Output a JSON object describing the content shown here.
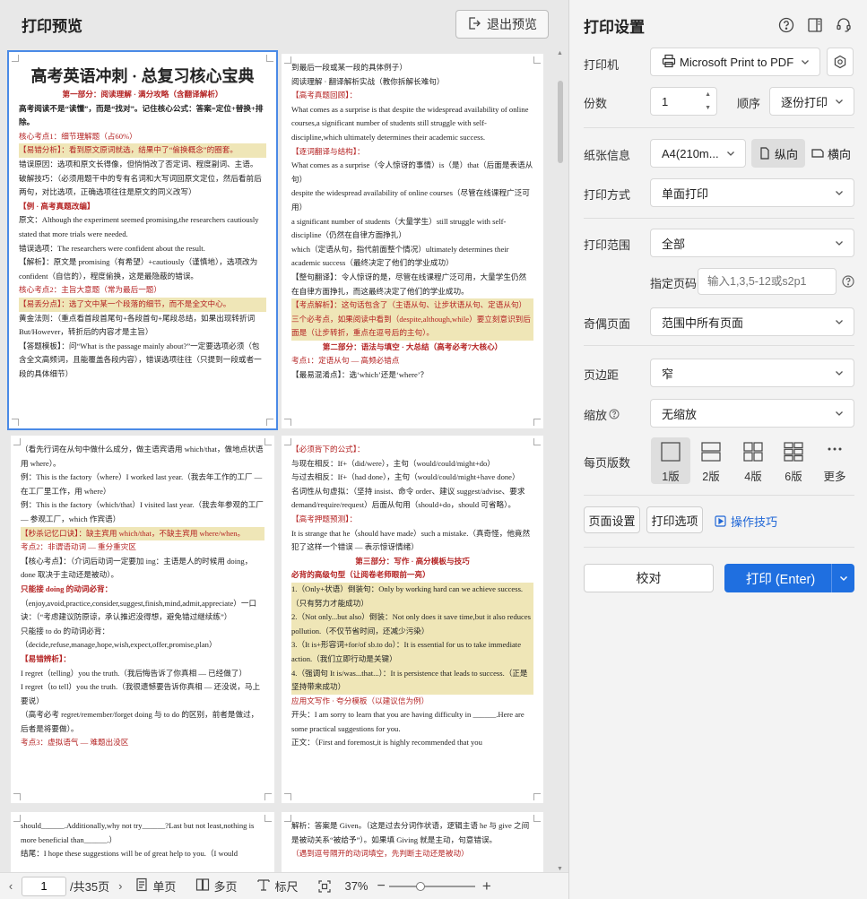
{
  "preview": {
    "title": "打印预览",
    "exit_label": "退出预览",
    "pages": [
      {
        "title": "高考英语冲刺 · 总复习核心宝典",
        "lines": [
          {
            "t": "第一部分：阅读理解 · 满分攻略（含翻译解析）",
            "c": "red bold center"
          },
          {
            "t": "高考阅读不是“读懂”，而是“找对”。记住核心公式：答案=定位+替换+排除。",
            "c": "bold"
          },
          {
            "t": "核心考点1：细节理解题（占60%）",
            "c": "red"
          },
          {
            "t": "【易错分析】：看到原文原词就选，结果中了“偷换概念”的圈套。",
            "c": "red hl"
          },
          {
            "t": "错误原因：选项和原文长得像，但悄悄改了否定词、程度副词、主语。",
            "c": ""
          },
          {
            "t": "破解技巧：（必须用题干中的专有名词和大写词回原文定位，然后看前后两句，对比选项，正确选项往往是原文的同义改写）",
            "c": ""
          },
          {
            "t": "【例 · 高考真题改编】",
            "c": "red bold"
          },
          {
            "t": "原文：Although the experiment seemed promising,the researchers cautiously stated that more trials were needed.",
            "c": ""
          },
          {
            "t": "错误选项：The researchers were confident about the result.",
            "c": ""
          },
          {
            "t": "【解析】：原文是 promising（有希望）+cautiously（谨慎地），选项改为 confident（自信的），程度偷换，这是最隐蔽的错误。",
            "c": ""
          },
          {
            "t": "核心考点2：主旨大意题（常为最后一题）",
            "c": "red"
          },
          {
            "t": "【易丢分点】：选了文中某一个段落的细节，而不是全文中心。",
            "c": "red hl"
          },
          {
            "t": "黄金法则：（重点看首段首尾句+各段首句+尾段总结，如果出现转折词 But/However，转折后的内容才是主旨）",
            "c": ""
          },
          {
            "t": "【答题模板】：问“What is the passage mainly about?”一定要选项必须（包含全文高频词，且能覆盖各段内容），错误选项往往（只提到一段或者一段的具体细节）",
            "c": ""
          }
        ]
      },
      {
        "lines": [
          {
            "t": "到最后一段或某一段的具体例子）",
            "c": ""
          },
          {
            "t": "阅读理解 · 翻译解析实战（教你拆解长难句）",
            "c": ""
          },
          {
            "t": "【高考真题回顾】：",
            "c": "red"
          },
          {
            "t": "What comes as a surprise is that despite the widespread availability of online courses,a significant number of students still struggle with self-discipline,which ultimately determines their academic success.",
            "c": ""
          },
          {
            "t": "【逐词翻译与结构】：",
            "c": "red"
          },
          {
            "t": "What comes as a surprise（令人惊讶的事情）is（是）that（后面是表语从句）",
            "c": ""
          },
          {
            "t": "despite the widespread availability of online courses（尽管在线课程广泛可用）",
            "c": ""
          },
          {
            "t": "a significant number of students（大量学生）still struggle with self-discipline（仍然在自律方面挣扎）",
            "c": ""
          },
          {
            "t": "which（定语从句，指代前面整个情况）ultimately determines their academic success（最终决定了他们的学业成功）",
            "c": ""
          },
          {
            "t": "【整句翻译】：令人惊讶的是，尽管在线课程广泛可用，大量学生仍然在自律方面挣扎，而这最终决定了他们的学业成功。",
            "c": ""
          },
          {
            "t": "【考点解析】：这句话包含了（主语从句、让步状语从句、定语从句）三个必考点，如果阅读中看到（despite,although,while）要立刻意识到后面是（让步转折，重点在逗号后的主句）。",
            "c": "red hl"
          },
          {
            "t": "第二部分：语法与填空 · 大总结（高考必考7大核心）",
            "c": "red bold center"
          },
          {
            "t": "考点1：定语从句 — 高频必错点",
            "c": "red"
          },
          {
            "t": "【最易混淆点】：选‘which’还是‘where’？",
            "c": ""
          }
        ]
      },
      {
        "lines": [
          {
            "t": "（看先行词在从句中做什么成分，做主语宾语用 which/that，做地点状语用 where）。",
            "c": ""
          },
          {
            "t": "例：This is the factory（where）I worked last year.（我去年工作的工厂 — 在工厂里工作，用 where）",
            "c": ""
          },
          {
            "t": "例：This is the factory（which/that）I visited last year.（我去年参观的工厂 — 参观工厂，which 作宾语）",
            "c": ""
          },
          {
            "t": "【秒杀记忆口诀】：缺主宾用 which/that，不缺主宾用 where/when。",
            "c": "red hl"
          },
          {
            "t": "考点2：非谓语动词 — 重分重灾区",
            "c": "red"
          },
          {
            "t": "【核心考点】：（介词后动词一定要加 ing：主语是人的时候用 doing，done 取决于主动还是被动）。",
            "c": ""
          },
          {
            "t": "只能接 doing 的动词必背：",
            "c": "red bold"
          },
          {
            "t": "（enjoy,avoid,practice,consider,suggest,finish,mind,admit,appreciate）一口诀：（“考虑建议防原谅，承认推迟没得想，避免错过继续练”）",
            "c": ""
          },
          {
            "t": "只能接 to do 的动词必背：",
            "c": ""
          },
          {
            "t": "（decide,refuse,manage,hope,wish,expect,offer,promise,plan）",
            "c": ""
          },
          {
            "t": "【易错辨析】：",
            "c": "red bold"
          },
          {
            "t": "I regret（telling）you the truth.（我后悔告诉了你真相 — 已经做了）",
            "c": ""
          },
          {
            "t": "I regret（to tell）you the truth.（我很遗憾要告诉你真相 — 还没说，马上要说）",
            "c": ""
          },
          {
            "t": "（高考必考 regret/remember/forget doing 与 to do 的区别，前者是做过，后者是将要做）。",
            "c": ""
          },
          {
            "t": "考点3：虚拟语气 — 难题出没区",
            "c": "red"
          }
        ]
      },
      {
        "lines": [
          {
            "t": "【必须背下的公式】：",
            "c": "red"
          },
          {
            "t": "与现在相反：If+（did/were），主句（would/could/might+do）",
            "c": ""
          },
          {
            "t": "与过去相反：If+（had done），主句（would/could/might+have done）",
            "c": ""
          },
          {
            "t": "名词性从句虚拟：（坚持 insist、命令 order、建议 suggest/advise、要求 demand/require/request）后面从句用（should+do，should 可省略）。",
            "c": ""
          },
          {
            "t": "【高考押题预测】：",
            "c": "red"
          },
          {
            "t": "It is strange that he（should have made）such a mistake.（真奇怪，他竟然犯了这样一个错误 — 表示惊讶情绪）",
            "c": ""
          },
          {
            "t": "第三部分：写作 · 高分模板与技巧",
            "c": "red bold center"
          },
          {
            "t": "必背的高级句型（让阅卷老师眼前一亮）",
            "c": "red bold"
          },
          {
            "t": "1.（Only+状语）倒装句：Only by working hard can we achieve success.（只有努力才能成功）",
            "c": "hl"
          },
          {
            "t": "2.（Not only...but also）倒装：Not only does it save time,but it also reduces pollution.（不仅节省时间，还减少污染）",
            "c": "hl"
          },
          {
            "t": "3.（It is+形容词+for/of sb.to do）：It is essential for us to take immediate action.（我们立即行动是关键）",
            "c": "hl"
          },
          {
            "t": "4.（强调句 It is/was...that...）：It is persistence that leads to success.（正是坚持带来成功）",
            "c": "hl"
          },
          {
            "t": "应用文写作 · 夸分模板（以建议信为例）",
            "c": "red"
          },
          {
            "t": "开头：I am sorry to learn that you are having difficulty in ______.Here are some practical suggestions for you.",
            "c": ""
          },
          {
            "t": "正文：（First and foremost,it is highly recommended that you",
            "c": ""
          }
        ]
      },
      {
        "lines": [
          {
            "t": "should______.Additionally,why not try______?Last but not least,nothing is more beneficial than______.）",
            "c": ""
          },
          {
            "t": "结尾：I hope these suggestions will be of great help to you.（I would",
            "c": ""
          }
        ]
      },
      {
        "lines": [
          {
            "t": "解析：答案是 Given。（这是过去分词作状语，逻辑主语 he 与 give 之间是被动关系“被给予”）。如果填 Giving 就是主动，句意错误。",
            "c": ""
          },
          {
            "t": "（遇到逗号隔开的动词填空，先判断主动还是被动）",
            "c": "red"
          }
        ]
      }
    ]
  },
  "status_bar": {
    "page_input": "1",
    "total_pages": "/共35页",
    "single_page": "单页",
    "multi_page": "多页",
    "ruler": "标尺",
    "zoom": "37%",
    "zoom_fraction": 0.37
  },
  "settings": {
    "title": "打印设置",
    "printer_label": "打印机",
    "printer_value": "Microsoft Print to PDF",
    "copies_label": "份数",
    "copies_value": "1",
    "order_label": "顺序",
    "order_value": "逐份打印",
    "paper_label": "纸张信息",
    "paper_value": "A4(210m...",
    "portrait_label": "纵向",
    "landscape_label": "横向",
    "mode_label": "打印方式",
    "mode_value": "单面打印",
    "range_label": "打印范围",
    "range_value": "全部",
    "pages_label": "指定页码",
    "pages_placeholder": "输入1,3,5-12或s2p1",
    "oddeven_label": "奇偶页面",
    "oddeven_value": "范围中所有页面",
    "margin_label": "页边距",
    "margin_value": "窄",
    "scale_label": "缩放",
    "scale_value": "无缩放",
    "layout_label": "每页版数",
    "layouts": [
      "1版",
      "2版",
      "4版",
      "6版",
      "更多"
    ],
    "page_setup": "页面设置",
    "print_options": "打印选项",
    "tips": "操作技巧",
    "proof": "校对",
    "print": "打印 (Enter)",
    "accent_color": "#1f6fe0"
  }
}
